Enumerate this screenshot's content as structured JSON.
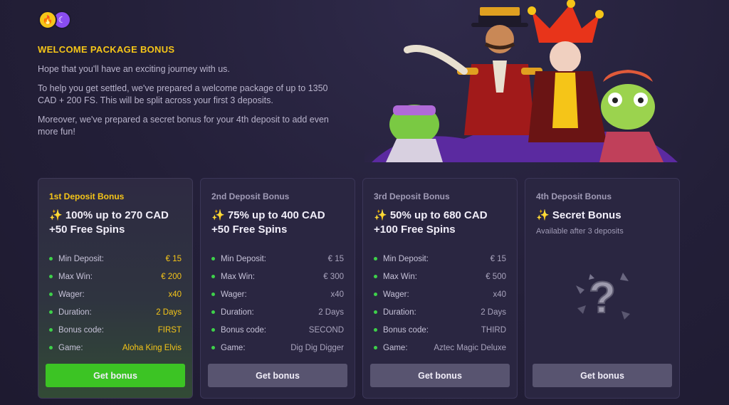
{
  "header": {
    "title": "WELCOME PACKAGE BONUS",
    "paragraphs": [
      "Hope that you'll have an exciting journey with us.",
      "To help you get settled, we've prepared a welcome package of up to 1350 CAD + 200 FS. This will be split across your first 3 deposits.",
      "Moreover, we've prepared a secret bonus for your 4th deposit to add even more fun!"
    ]
  },
  "icons": {
    "fire": "fire-icon",
    "moon": "moon-icon"
  },
  "colors": {
    "accent": "#f5c518",
    "green": "#3cc424",
    "bullet": "#3ed14a"
  },
  "cards": [
    {
      "label": "1st Deposit Bonus",
      "title": "✨ 100% up to 270 CAD +50 Free Spins",
      "rows": [
        {
          "key": "Min Deposit:",
          "value": "€ 15"
        },
        {
          "key": "Max Win:",
          "value": "€ 200"
        },
        {
          "key": "Wager:",
          "value": "x40"
        },
        {
          "key": "Duration:",
          "value": "2 Days"
        },
        {
          "key": "Bonus code:",
          "value": "FIRST"
        },
        {
          "key": "Game:",
          "value": "Aloha King Elvis"
        }
      ],
      "button": "Get bonus"
    },
    {
      "label": "2nd Deposit Bonus",
      "title": "✨ 75% up to 400 CAD +50 Free Spins",
      "rows": [
        {
          "key": "Min Deposit:",
          "value": "€ 15"
        },
        {
          "key": "Max Win:",
          "value": "€ 300"
        },
        {
          "key": "Wager:",
          "value": "x40"
        },
        {
          "key": "Duration:",
          "value": "2 Days"
        },
        {
          "key": "Bonus code:",
          "value": "SECOND"
        },
        {
          "key": "Game:",
          "value": "Dig Dig Digger"
        }
      ],
      "button": "Get bonus"
    },
    {
      "label": "3rd Deposit Bonus",
      "title": "✨ 50% up to 680 CAD +100 Free Spins",
      "rows": [
        {
          "key": "Min Deposit:",
          "value": "€ 15"
        },
        {
          "key": "Max Win:",
          "value": "€ 500"
        },
        {
          "key": "Wager:",
          "value": "x40"
        },
        {
          "key": "Duration:",
          "value": "2 Days"
        },
        {
          "key": "Bonus code:",
          "value": "THIRD"
        },
        {
          "key": "Game:",
          "value": "Aztec Magic Deluxe"
        }
      ],
      "button": "Get bonus"
    },
    {
      "label": "4th Deposit Bonus",
      "title": "✨ Secret Bonus",
      "subtitle": "Available after 3 deposits",
      "mystery_icon": "question-mark-icon",
      "button": "Get bonus"
    }
  ]
}
